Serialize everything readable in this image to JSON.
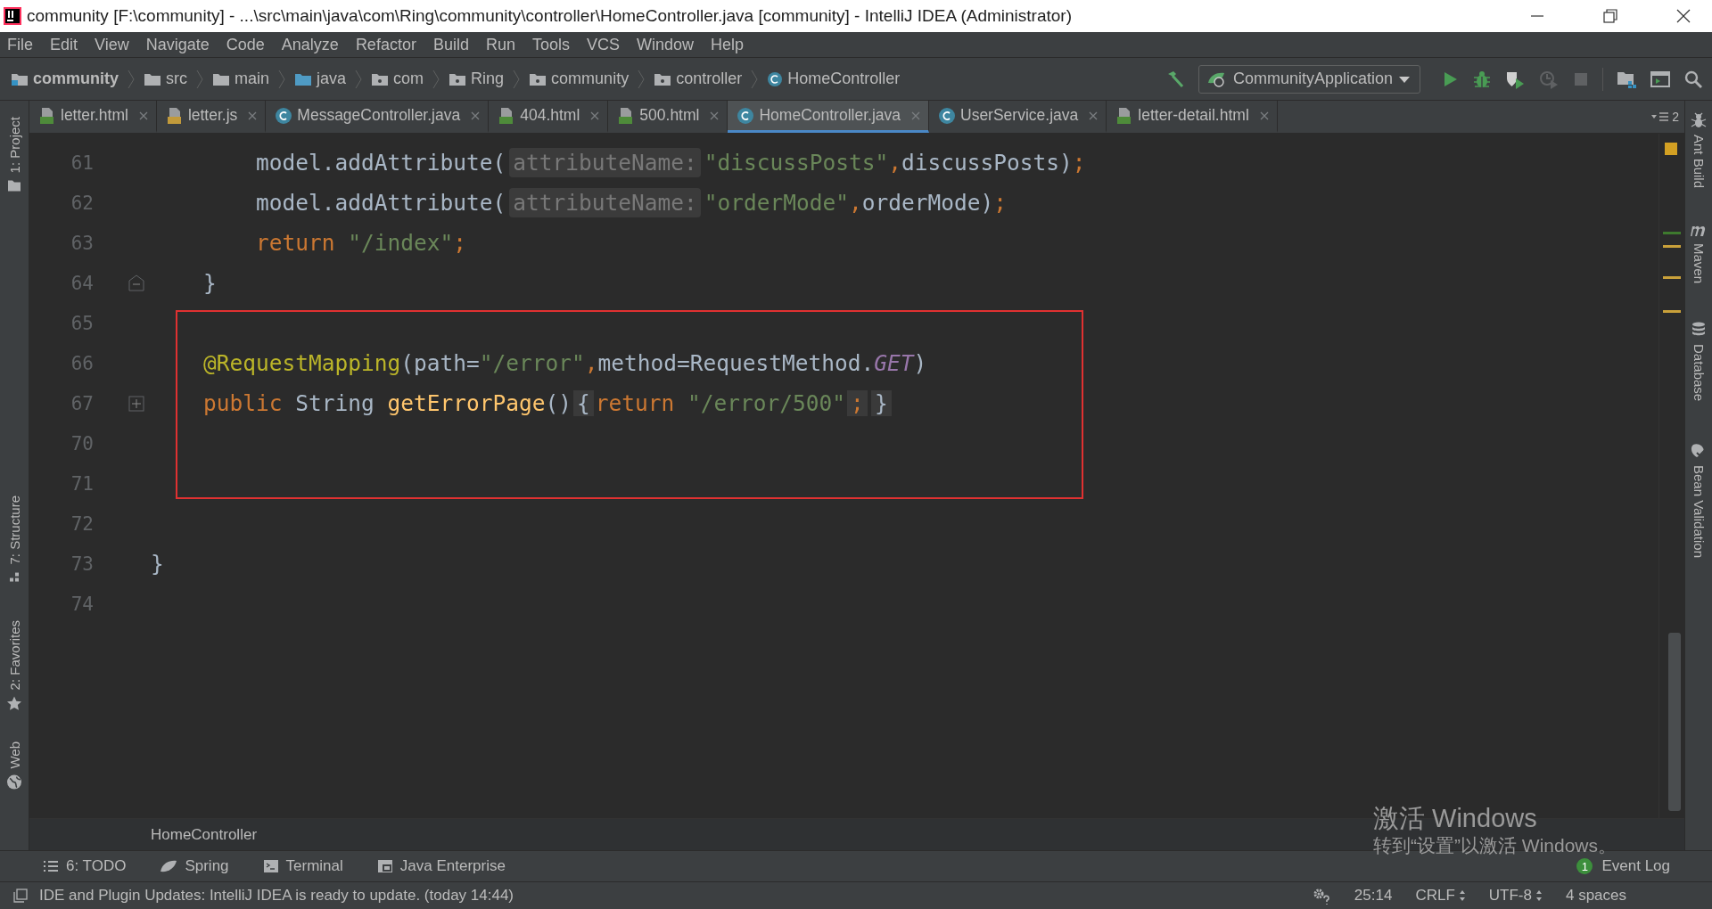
{
  "window": {
    "title": "community [F:\\community] - ...\\src\\main\\java\\com\\Ring\\community\\controller\\HomeController.java [community] - IntelliJ IDEA (Administrator)"
  },
  "menu": [
    "File",
    "Edit",
    "View",
    "Navigate",
    "Code",
    "Analyze",
    "Refactor",
    "Build",
    "Run",
    "Tools",
    "VCS",
    "Window",
    "Help"
  ],
  "breadcrumb": [
    {
      "label": "community",
      "kind": "project"
    },
    {
      "label": "src",
      "kind": "folder"
    },
    {
      "label": "main",
      "kind": "folder"
    },
    {
      "label": "java",
      "kind": "source"
    },
    {
      "label": "com",
      "kind": "package"
    },
    {
      "label": "Ring",
      "kind": "package"
    },
    {
      "label": "community",
      "kind": "package"
    },
    {
      "label": "controller",
      "kind": "package"
    },
    {
      "label": "HomeController",
      "kind": "class"
    }
  ],
  "run_config": "CommunityApplication",
  "tabs": [
    {
      "label": "letter.html",
      "kind": "html",
      "selected": false
    },
    {
      "label": "letter.js",
      "kind": "js",
      "selected": false
    },
    {
      "label": "MessageController.java",
      "kind": "class",
      "selected": false
    },
    {
      "label": "404.html",
      "kind": "html",
      "selected": false
    },
    {
      "label": "500.html",
      "kind": "html",
      "selected": false
    },
    {
      "label": "HomeController.java",
      "kind": "class",
      "selected": true
    },
    {
      "label": "UserService.java",
      "kind": "class",
      "selected": false
    },
    {
      "label": "letter-detail.html",
      "kind": "html",
      "selected": false
    }
  ],
  "tab_overflow_count": "2",
  "left_tool_tabs": [
    {
      "label": "1: Project",
      "kind": "project"
    },
    {
      "label": "7: Structure",
      "kind": "structure"
    },
    {
      "label": "2: Favorites",
      "kind": "favorites"
    },
    {
      "label": "Web",
      "kind": "web"
    }
  ],
  "right_tool_tabs": [
    {
      "label": "Ant Build",
      "kind": "ant"
    },
    {
      "label": "Maven",
      "kind": "maven"
    },
    {
      "label": "Database",
      "kind": "database"
    },
    {
      "label": "Bean Validation",
      "kind": "bean"
    }
  ],
  "code_lines": [
    {
      "number": "61",
      "boxed": false,
      "tokens": [
        {
          "kind": "plain",
          "text": "        model.addAttribute("
        },
        {
          "kind": "hint",
          "text": "attributeName:"
        },
        {
          "kind": "string",
          "text": "\"discussPosts\""
        },
        {
          "kind": "keyword",
          "text": ","
        },
        {
          "kind": "plain",
          "text": "discussPosts)"
        },
        {
          "kind": "keyword",
          "text": ";"
        }
      ]
    },
    {
      "number": "62",
      "boxed": false,
      "tokens": [
        {
          "kind": "plain",
          "text": "        model.addAttribute("
        },
        {
          "kind": "hint",
          "text": "attributeName:"
        },
        {
          "kind": "string",
          "text": "\"orderMode\""
        },
        {
          "kind": "keyword",
          "text": ","
        },
        {
          "kind": "plain",
          "text": "orderMode)"
        },
        {
          "kind": "keyword",
          "text": ";"
        }
      ]
    },
    {
      "number": "63",
      "boxed": false,
      "tokens": [
        {
          "kind": "keyword",
          "text": "        return "
        },
        {
          "kind": "string",
          "text": "\"/index\""
        },
        {
          "kind": "keyword",
          "text": ";"
        }
      ]
    },
    {
      "number": "64",
      "boxed": false,
      "folded": false,
      "tokens": [
        {
          "kind": "plain",
          "text": "    }"
        }
      ]
    },
    {
      "number": "65",
      "boxed": true
    },
    {
      "number": "66",
      "boxed": true,
      "tokens": [
        {
          "kind": "annotation",
          "text": "    @RequestMapping"
        },
        {
          "kind": "plain",
          "text": "(path="
        },
        {
          "kind": "string",
          "text": "\"/error\""
        },
        {
          "kind": "keyword",
          "text": ","
        },
        {
          "kind": "plain",
          "text": "method=RequestMethod."
        },
        {
          "kind": "constant",
          "text": "GET"
        },
        {
          "kind": "plain",
          "text": ")"
        }
      ]
    },
    {
      "number": "67",
      "boxed": true,
      "folded": true,
      "tokens": [
        {
          "kind": "keyword",
          "text": "    public "
        },
        {
          "kind": "plain",
          "text": "String "
        },
        {
          "kind": "method",
          "text": "getErrorPage"
        },
        {
          "kind": "plain",
          "text": "()"
        },
        {
          "kind": "fold",
          "text": "{"
        },
        {
          "kind": "keyword",
          "text": "return "
        },
        {
          "kind": "string",
          "text": "\"/error/500\""
        },
        {
          "kind": "fold_keyword",
          "text": ";"
        },
        {
          "kind": "fold",
          "text": "}"
        }
      ]
    },
    {
      "number": "70",
      "boxed": true
    },
    {
      "number": "71",
      "boxed": true
    },
    {
      "number": "72",
      "boxed": false
    },
    {
      "number": "73",
      "boxed": false,
      "tokens": [
        {
          "kind": "plain",
          "text": "}"
        }
      ]
    },
    {
      "number": "74",
      "boxed": false
    }
  ],
  "editor_breadcrumb": "HomeController",
  "bottom_tool_tabs": [
    {
      "label": "6: TODO",
      "kind": "todo"
    },
    {
      "label": "Spring",
      "kind": "spring"
    },
    {
      "label": "Terminal",
      "kind": "terminal"
    },
    {
      "label": "Java Enterprise",
      "kind": "javaee"
    }
  ],
  "event_log": {
    "label": "Event Log",
    "count": "1"
  },
  "status_bar": {
    "message": "IDE and Plugin Updates: IntelliJ IDEA is ready to update. (today 14:44)",
    "position": "25:14",
    "line_separator": "CRLF",
    "encoding": "UTF-8",
    "indent": "4 spaces"
  },
  "os_notice": {
    "title": "激活 Windows",
    "text": "转到“设置”以激活 Windows。"
  }
}
